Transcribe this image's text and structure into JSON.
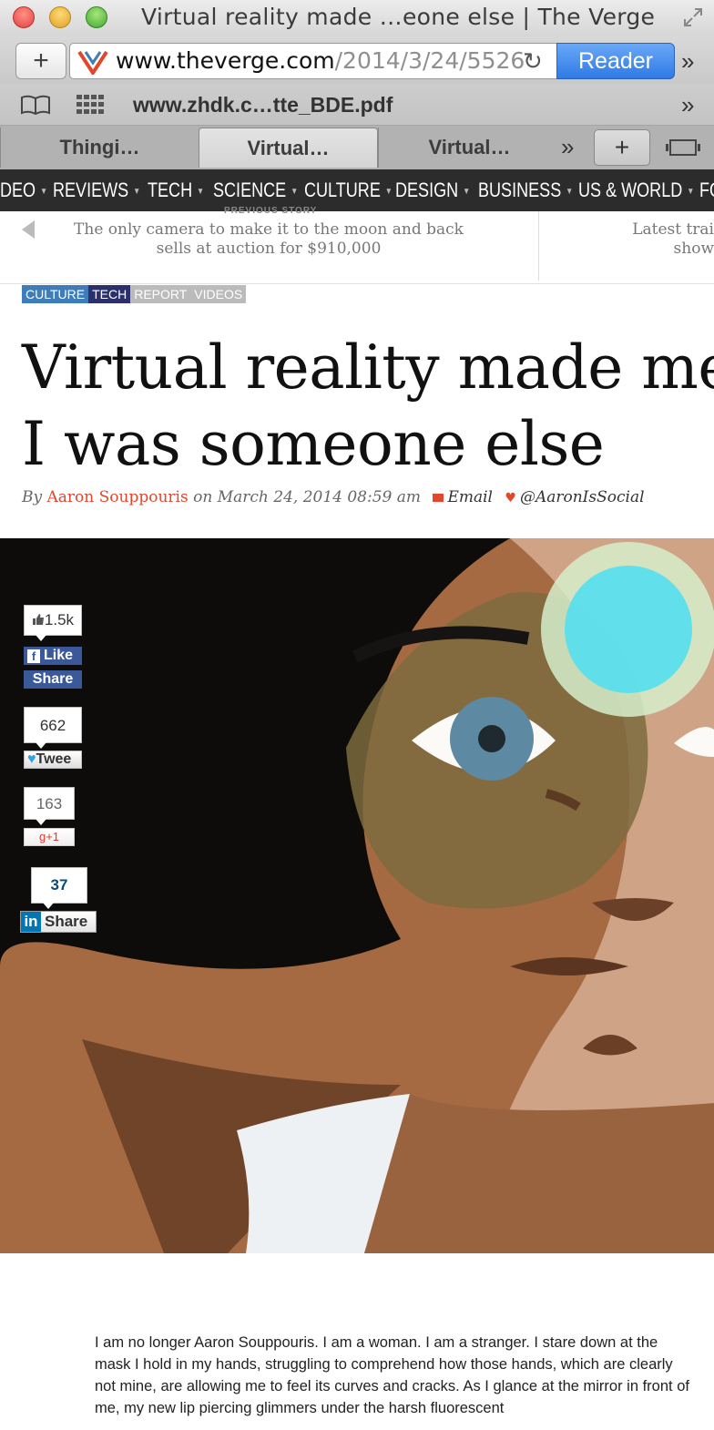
{
  "window": {
    "title": "Virtual reality made …eone else | The Verge"
  },
  "toolbar": {
    "new_tab_label": "+",
    "url_host": "www.theverge.com",
    "url_path": "/2014/3/24/5526",
    "reader_label": "Reader",
    "overflow_label": "»"
  },
  "bookmarks": {
    "item": "www.zhdk.c…tte_BDE.pdf",
    "overflow_label": "»"
  },
  "tabs": [
    {
      "label": "Thingi…"
    },
    {
      "label": "Virtual…"
    },
    {
      "label": "Virtual…"
    }
  ],
  "tabbar": {
    "overflow_label": "»",
    "new_tab_label": "+"
  },
  "site_nav": [
    {
      "label": "DEO"
    },
    {
      "label": "REVIEWS"
    },
    {
      "label": "TECH"
    },
    {
      "label": "SCIENCE"
    },
    {
      "label": "CULTURE"
    },
    {
      "label": "DESIGN"
    },
    {
      "label": "BUSINESS"
    },
    {
      "label": "US & WORLD"
    },
    {
      "label": "FO"
    }
  ],
  "strip": {
    "prev_label": "PREVIOUS STORY",
    "prev_title": "The only camera to make it to the moon and back sells at auction for $910,000",
    "next_title_line1": "Latest trai",
    "next_title_line2": "show"
  },
  "tags": [
    {
      "label": "CULTURE",
      "color": "#3e7db9"
    },
    {
      "label": "TECH",
      "color": "#2b2f6b"
    },
    {
      "label": "REPORT",
      "color": "#bbbbbb"
    },
    {
      "label": "VIDEOS",
      "color": "#bbbbbb"
    }
  ],
  "article": {
    "headline_line1": "Virtual reality made me",
    "headline_line2": "I was someone else",
    "by_label": "By",
    "author": "Aaron Souppouris",
    "on_label": "on",
    "date": "March 24, 2014 08:59 am",
    "email_label": "Email",
    "twitter_handle": "@AaronIsSocial",
    "body": "I am no longer Aaron Souppouris. I am a woman. I am a stranger. I stare down at the mask I hold in my hands, struggling to comprehend how those hands, which are clearly not mine, are allowing me to feel its curves and cracks. As I glance at the mirror in front of me, my new lip piercing glimmers under the harsh fluorescent"
  },
  "share": {
    "fb_count": "1.5k",
    "fb_like": "Like",
    "fb_share": "Share",
    "tw_count": "662",
    "tw_label": "Twee",
    "gp_count": "163",
    "gp_label": "g+1",
    "li_count": "37",
    "li_label": "Share"
  },
  "colors": {
    "accent": "#e2462b",
    "nav_bg": "#2c2c2c",
    "reader_button": "#2f7ae6"
  }
}
